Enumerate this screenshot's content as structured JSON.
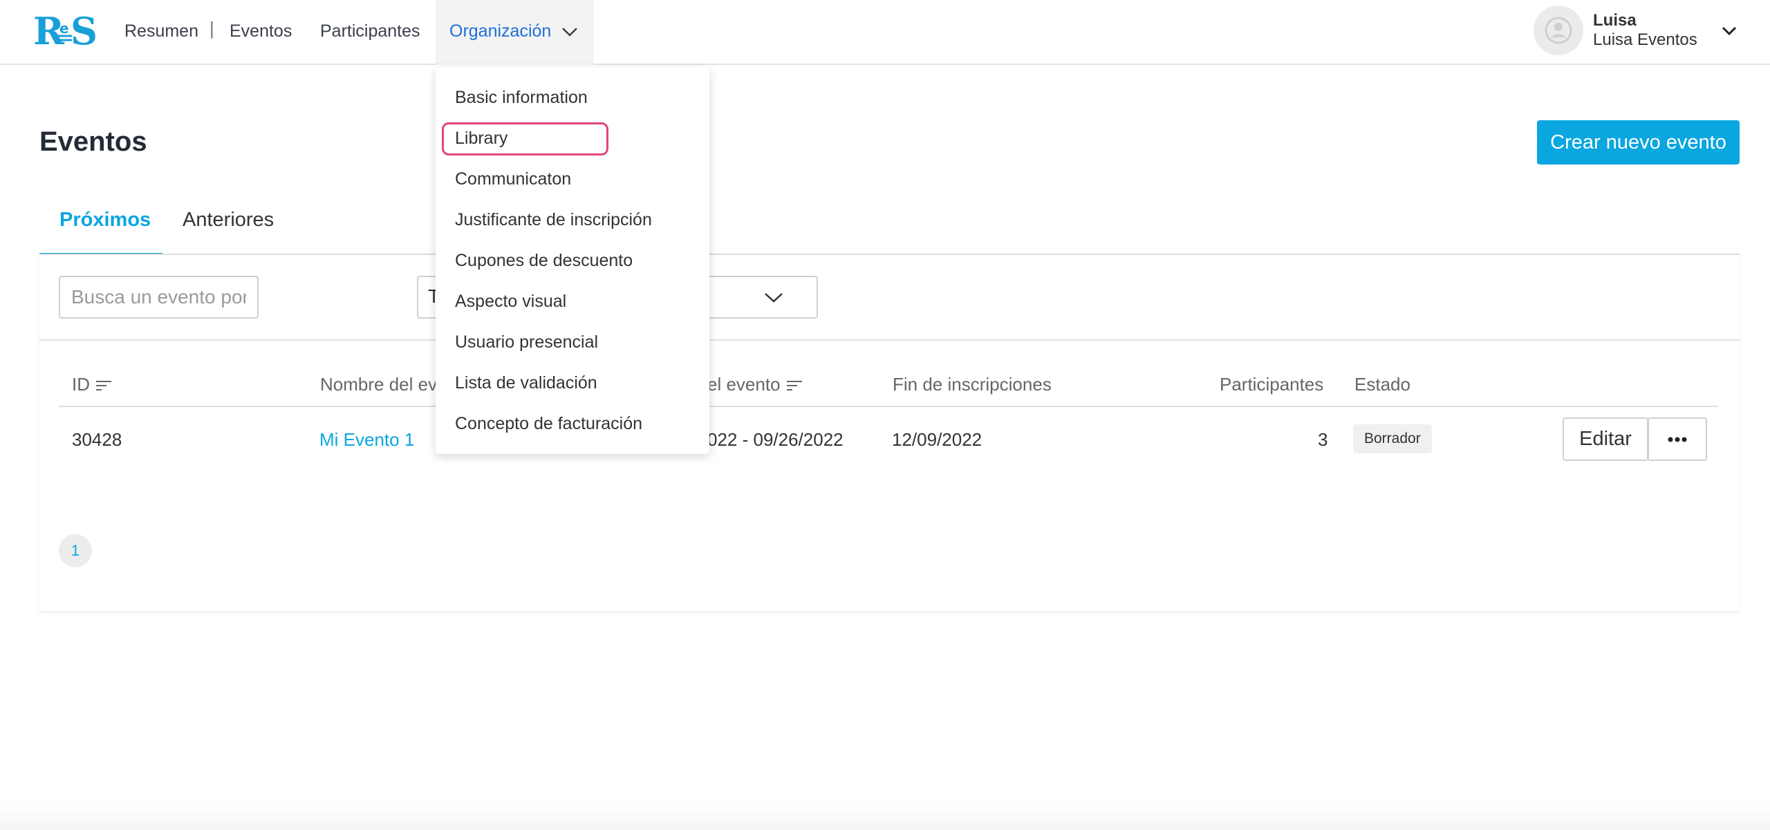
{
  "app": {
    "logo_letters": "RES"
  },
  "nav": {
    "items": [
      "Resumen",
      "|",
      "Eventos",
      "Participantes",
      "Organización"
    ]
  },
  "user": {
    "name": "Luisa",
    "org": "Luisa Eventos"
  },
  "page": {
    "title": "Eventos",
    "create_button": "Crear nuevo evento"
  },
  "tabs": [
    {
      "label": "Próximos",
      "active": true
    },
    {
      "label": "Anteriores",
      "active": false
    }
  ],
  "filters": {
    "search_placeholder": "Busca un evento por su nombre",
    "select_value": "T"
  },
  "table": {
    "headers": [
      "ID",
      "Nombre del ev",
      "el evento",
      "Fin de inscripciones",
      "Participantes",
      "Estado"
    ],
    "rows": [
      {
        "id": "30428",
        "name": "Mi Evento 1",
        "dates": "022 - 09/26/2022",
        "registration_end": "12/09/2022",
        "participants": "3",
        "status": "Borrador"
      }
    ],
    "edit_label": "Editar"
  },
  "pagination": {
    "current": "1"
  },
  "org_menu": {
    "items": [
      "Basic information",
      "Library",
      "Communicaton",
      "Justificante de inscripción",
      "Cupones de descuento",
      "Aspecto visual",
      "Usuario presencial",
      "Lista de validación",
      "Concepto de facturación"
    ],
    "highlighted": "Library"
  },
  "colors": {
    "accent": "#0aa6e0",
    "nav_active": "#1d6fd8",
    "highlight_border": "#e0457b"
  }
}
